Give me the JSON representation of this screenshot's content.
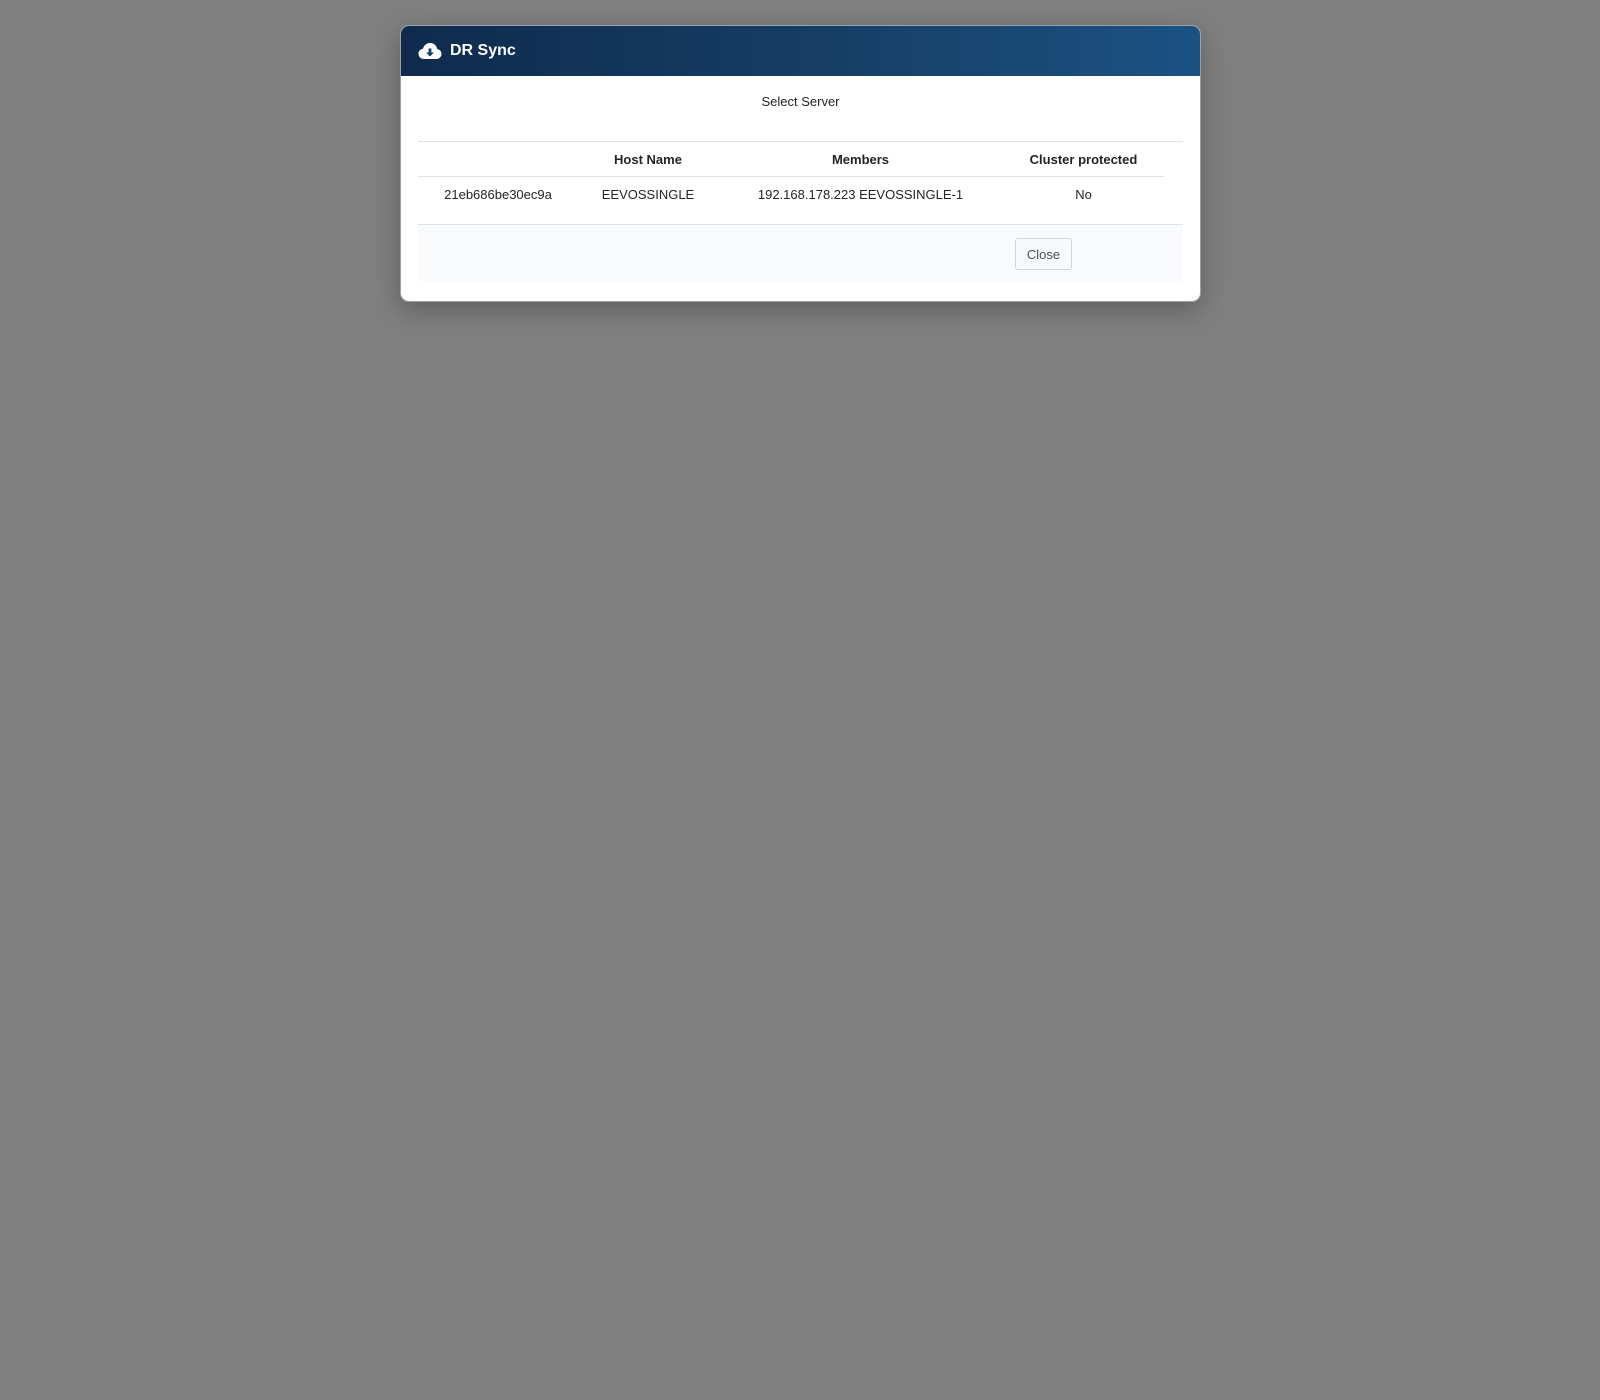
{
  "modal": {
    "title": "DR Sync",
    "header_icon": "cloud-download-icon",
    "subtitle": "Select Server"
  },
  "table": {
    "columns": [
      "",
      "Host Name",
      "Members",
      "Cluster protected"
    ],
    "rows": [
      {
        "id": "21eb686be30ec9a",
        "host_name": "EEVOSSINGLE",
        "members": "192.168.178.223 EEVOSSINGLE-1",
        "cluster_protected": "No"
      }
    ]
  },
  "footer": {
    "close_label": "Close"
  },
  "colors": {
    "backdrop": "#808080",
    "header_dark": "#0f2a4d",
    "header_light": "#1b5283"
  }
}
